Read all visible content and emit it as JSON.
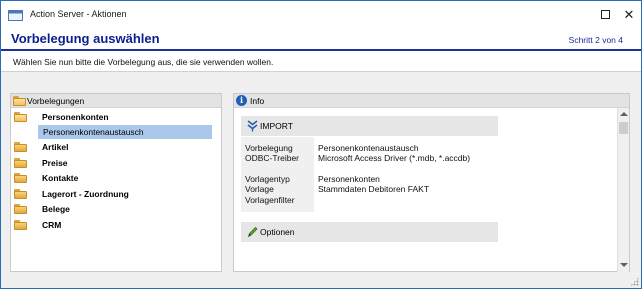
{
  "window": {
    "title": "Action Server - Aktionen",
    "app_icon": "app-icon",
    "maximize_icon": "maximize-icon",
    "close_icon": "close-icon",
    "close_glyph": "✕"
  },
  "header": {
    "title": "Vorbelegung auswählen",
    "step": "Schritt 2 von 4",
    "accent_color": "#1e2f9c"
  },
  "instruction": "Wählen Sie nun bitte die Vorbelegung aus, die sie verwenden wollen.",
  "left_panel": {
    "header_label": "Vorbelegungen",
    "items": [
      {
        "label": "Personenkonten",
        "expanded": true
      },
      {
        "label": "Personenkontenaustausch",
        "selected": true,
        "child": true
      },
      {
        "label": "Artikel"
      },
      {
        "label": "Preise"
      },
      {
        "label": "Kontakte"
      },
      {
        "label": "Lagerort - Zuordnung"
      },
      {
        "label": "Belege"
      },
      {
        "label": "CRM"
      }
    ]
  },
  "right_panel": {
    "header_label": "Info",
    "import_section": {
      "label": "IMPORT",
      "fields": [
        {
          "label": "Vorbelegung",
          "value": "Personenkontenaustausch"
        },
        {
          "label": "ODBC-Treiber",
          "value": "Microsoft Access Driver (*.mdb, *.accdb)"
        },
        {
          "label": "Vorlagentyp",
          "value": "Personenkonten"
        },
        {
          "label": "Vorlage",
          "value": "Stammdaten Debitoren FAKT"
        },
        {
          "label": "Vorlagenfilter",
          "value": ""
        }
      ]
    },
    "options_section": {
      "label": "Optionen"
    }
  }
}
